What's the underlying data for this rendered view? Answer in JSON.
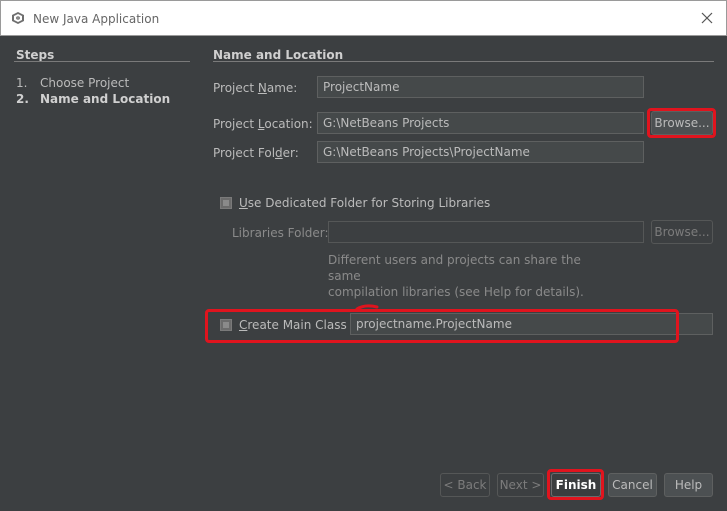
{
  "window": {
    "title": "New Java Application"
  },
  "steps": {
    "header": "Steps",
    "items": [
      {
        "num": "1.",
        "label": "Choose Project"
      },
      {
        "num": "2.",
        "label": "Name and Location"
      }
    ]
  },
  "section": {
    "header": "Name and Location"
  },
  "form": {
    "project_name_label_pre": "Project ",
    "project_name_label_key": "N",
    "project_name_label_post": "ame:",
    "project_name_value": "ProjectName",
    "project_location_label_pre": "Project ",
    "project_location_label_key": "L",
    "project_location_label_post": "ocation:",
    "project_location_value": "G:\\NetBeans Projects",
    "browse_label": "Browse...",
    "project_folder_label_pre": "Project Fol",
    "project_folder_label_key": "d",
    "project_folder_label_post": "er:",
    "project_folder_value": "G:\\NetBeans Projects\\ProjectName",
    "dedicated_folder_key": "U",
    "dedicated_folder_label": "se Dedicated Folder for Storing Libraries",
    "libraries_folder_label": "Libraries Folder:",
    "libraries_folder_value": "",
    "libraries_browse_label": "Browse...",
    "libraries_note_line1": "Different users and projects can share the same",
    "libraries_note_line2": "compilation libraries (see Help for details).",
    "create_main_class_key": "C",
    "create_main_class_label": "reate Main Class",
    "main_class_value": "projectname.ProjectName"
  },
  "buttons": {
    "back": "< Back",
    "next": "Next >",
    "finish": "Finish",
    "cancel": "Cancel",
    "help": "Help"
  },
  "colors": {
    "background": "#3c3f41",
    "annotation": "#e0141e"
  },
  "icons": {
    "app": "netbeans-cube-icon",
    "close": "close-icon"
  }
}
